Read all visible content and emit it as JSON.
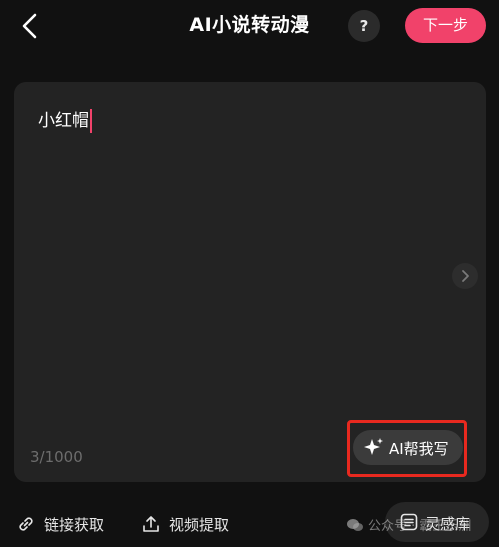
{
  "header": {
    "title": "AI小说转动漫",
    "help_label": "?",
    "next_label": "下一步"
  },
  "editor": {
    "text": "小红帽",
    "char_count": "3/1000"
  },
  "ai_button": {
    "label": "AI帮我写"
  },
  "toolbar": {
    "link_label": "链接获取",
    "video_label": "视频提取",
    "library_label": "灵感库"
  },
  "watermark": {
    "text": "公众号 · 霸王乐洲"
  },
  "colors": {
    "accent": "#f1426a",
    "highlight_box": "#e8291f",
    "background": "#111111",
    "panel": "#232323"
  },
  "icons": [
    "back-chevron-icon",
    "question-icon",
    "chevron-right-icon",
    "sparkle-icon",
    "link-icon",
    "upload-icon",
    "library-icon",
    "wechat-icon"
  ]
}
